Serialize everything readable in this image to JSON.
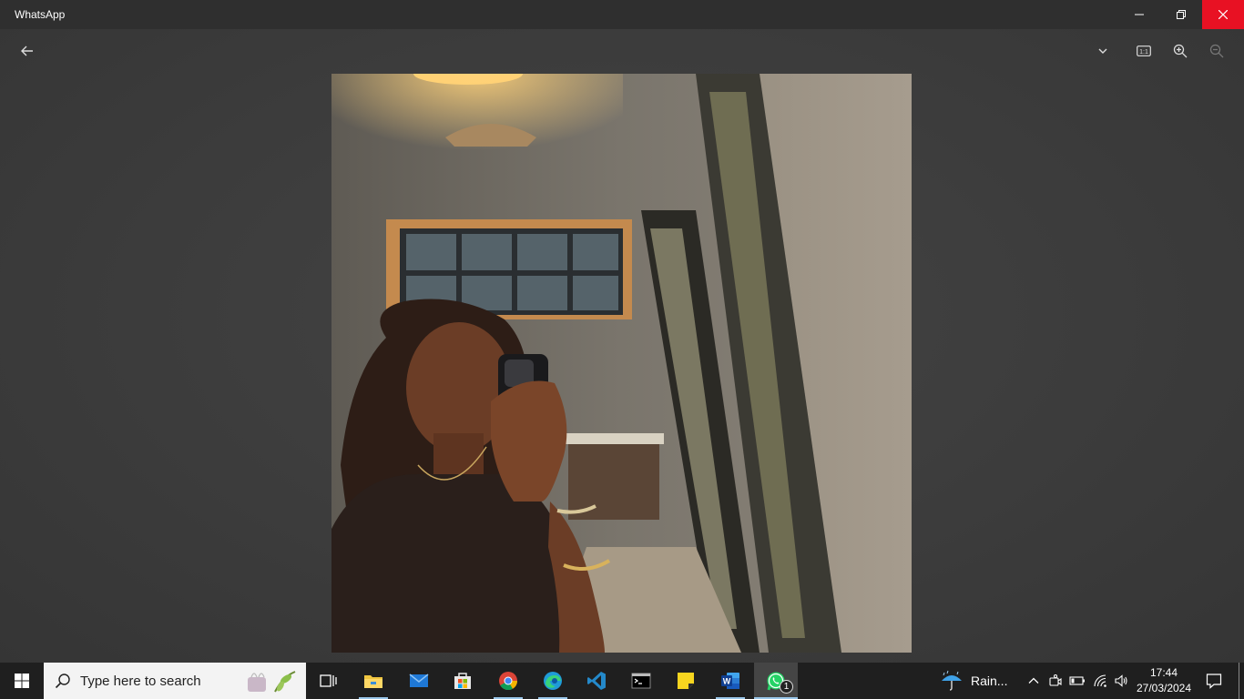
{
  "window": {
    "title": "WhatsApp"
  },
  "viewer": {
    "toolbar": {
      "back": "arrow-left-icon",
      "more": "chevron-down-icon",
      "actual_size": "actual-size-icon",
      "actual_size_label": "1:1",
      "zoom_in": "zoom-in-icon",
      "zoom_out": "zoom-out-icon"
    },
    "photo": "mirror selfie photo"
  },
  "taskbar": {
    "search_placeholder": "Type here to search",
    "apps": [
      "task-view",
      "file-explorer",
      "mail",
      "microsoft-store",
      "chrome",
      "edge",
      "vscode",
      "terminal",
      "sticky-notes",
      "word",
      "whatsapp"
    ],
    "whatsapp_badge": "1",
    "weather_text": "Rain...",
    "time": "17:44",
    "date": "27/03/2024",
    "accent_color": "#9ac7ea",
    "close_color": "#e81123"
  }
}
